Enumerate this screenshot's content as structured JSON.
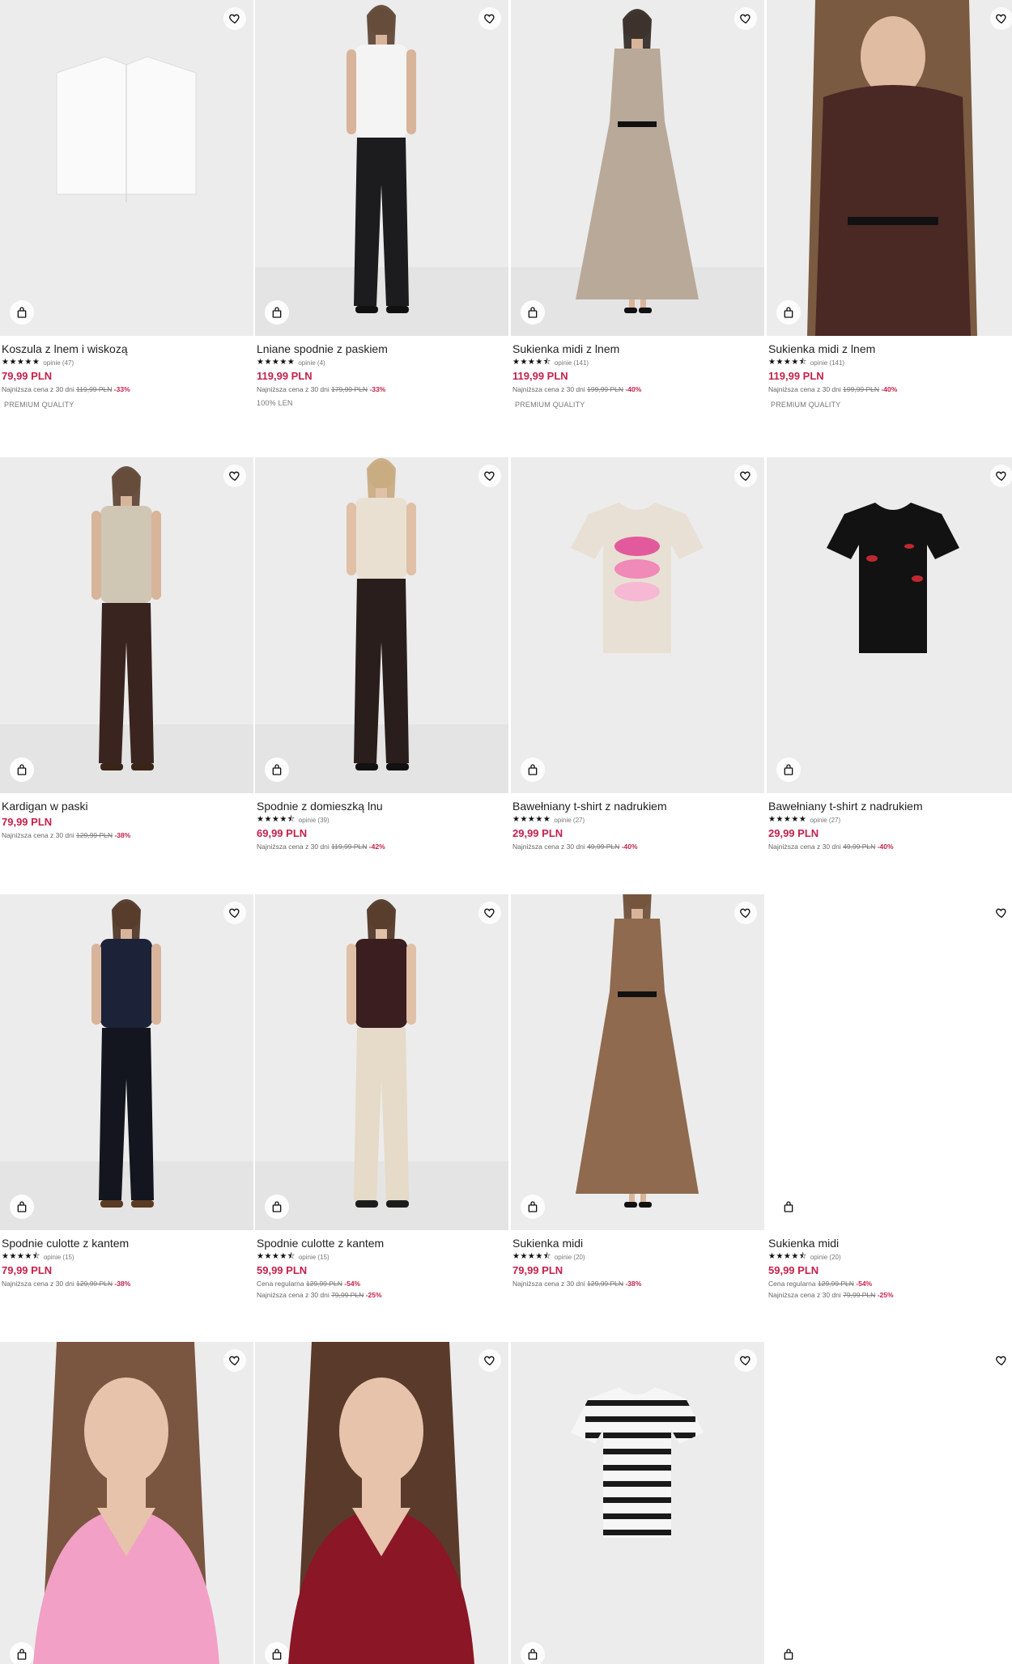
{
  "colors": {
    "price": "#c4214b",
    "placeholder_bg": "#ececec"
  },
  "products": [
    {
      "name": "Koszula z lnem i wiskozą",
      "stars": "★★★★★",
      "reviews": "opinie (47)",
      "price": "79,99 PLN",
      "line1_label": "Najniższa cena z 30 dni",
      "line1_old": "119,99 PLN",
      "line1_disc": "-33%",
      "tag": "PREMIUM QUALITY"
    },
    {
      "name": "Lniane spodnie z paskiem",
      "stars": "★★★★★",
      "reviews": "opinie (4)",
      "price": "119,99 PLN",
      "line1_label": "Najniższa cena z 30 dni",
      "line1_old": "179,99 PLN",
      "line1_disc": "-33%",
      "tag": "100% LEN"
    },
    {
      "name": "Sukienka midi z lnem",
      "stars": "★★★★⯪",
      "reviews": "opinie (141)",
      "price": "119,99 PLN",
      "line1_label": "Najniższa cena z 30 dni",
      "line1_old": "199,99 PLN",
      "line1_disc": "-40%",
      "tag": "PREMIUM QUALITY"
    },
    {
      "name": "Sukienka midi z lnem",
      "stars": "★★★★⯪",
      "reviews": "opinie (141)",
      "price": "119,99 PLN",
      "line1_label": "Najniższa cena z 30 dni",
      "line1_old": "199,99 PLN",
      "line1_disc": "-40%",
      "tag": "PREMIUM QUALITY"
    },
    {
      "name": "Kardigan w paski",
      "stars": "",
      "reviews": "",
      "price": "79,99 PLN",
      "line1_label": "Najniższa cena z 30 dni",
      "line1_old": "129,99 PLN",
      "line1_disc": "-38%"
    },
    {
      "name": "Spodnie z domieszką lnu",
      "stars": "★★★★⯪",
      "reviews": "opinie (39)",
      "price": "69,99 PLN",
      "line1_label": "Najniższa cena z 30 dni",
      "line1_old": "119,99 PLN",
      "line1_disc": "-42%"
    },
    {
      "name": "Bawełniany t-shirt z nadrukiem",
      "stars": "★★★★★",
      "reviews": "opinie (27)",
      "price": "29,99 PLN",
      "line1_label": "Najniższa cena z 30 dni",
      "line1_old": "49,99 PLN",
      "line1_disc": "-40%"
    },
    {
      "name": "Bawełniany t-shirt z nadrukiem",
      "stars": "★★★★★",
      "reviews": "opinie (27)",
      "price": "29,99 PLN",
      "line1_label": "Najniższa cena z 30 dni",
      "line1_old": "49,99 PLN",
      "line1_disc": "-40%"
    },
    {
      "name": "Spodnie culotte z kantem",
      "stars": "★★★★⯪",
      "reviews": "opinie (15)",
      "price": "79,99 PLN",
      "line1_label": "Najniższa cena z 30 dni",
      "line1_old": "129,99 PLN",
      "line1_disc": "-38%"
    },
    {
      "name": "Spodnie culotte z kantem",
      "stars": "★★★★⯪",
      "reviews": "opinie (15)",
      "price": "59,99 PLN",
      "line1_label": "Cena regularna",
      "line1_old": "129,99 PLN",
      "line1_disc": "-54%",
      "line2_label": "Najniższa cena z 30 dni",
      "line2_old": "79,99 PLN",
      "line2_disc": "-25%"
    },
    {
      "name": "Sukienka midi",
      "stars": "★★★★⯪",
      "reviews": "opinie (20)",
      "price": "79,99 PLN",
      "line1_label": "Najniższa cena z 30 dni",
      "line1_old": "129,99 PLN",
      "line1_disc": "-38%"
    },
    {
      "name": "Sukienka midi",
      "stars": "★★★★⯪",
      "reviews": "opinie (20)",
      "price": "59,99 PLN",
      "line1_label": "Cena regularna",
      "line1_old": "129,99 PLN",
      "line1_disc": "-54%",
      "line2_label": "Najniższa cena z 30 dni",
      "line2_old": "79,99 PLN",
      "line2_disc": "-25%"
    },
    {
      "name": "",
      "price": ""
    },
    {
      "name": "",
      "price": ""
    },
    {
      "name": "",
      "price": ""
    },
    {
      "name": "",
      "price": ""
    }
  ],
  "icons": {
    "favorite": "heart-icon",
    "add_to_bag": "shopping-bag-icon"
  }
}
